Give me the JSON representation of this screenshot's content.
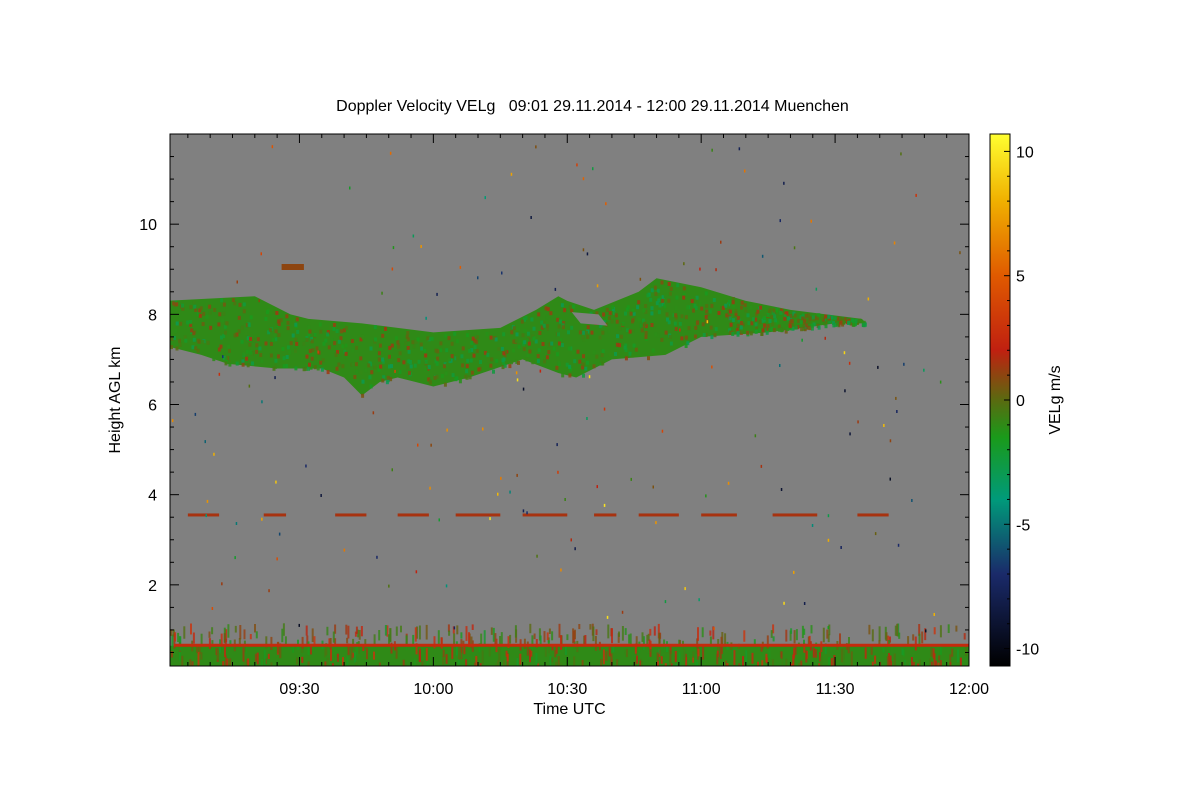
{
  "chart_data": {
    "type": "heatmap",
    "title": "Doppler Velocity VELg   09:01 29.11.2014 - 12:00 29.11.2014 Muenchen",
    "xlabel": "Time UTC",
    "ylabel": "Height AGL km",
    "x_ticks": [
      "09:30",
      "10:00",
      "10:30",
      "11:00",
      "11:30",
      "12:00"
    ],
    "x_tick_minutes": [
      30,
      60,
      90,
      120,
      150,
      180
    ],
    "xlim_minutes_after_0900": [
      1,
      180
    ],
    "y_ticks": [
      2,
      4,
      6,
      8,
      10
    ],
    "ylim": [
      0.2,
      12.0
    ],
    "colorbar": {
      "label": "VELg m/s",
      "ticks": [
        10,
        5,
        0,
        -5,
        -10
      ],
      "range": [
        -10.7,
        10.7
      ],
      "stops": [
        {
          "v": -10.7,
          "color": "#000000"
        },
        {
          "v": -7.0,
          "color": "#1a2a6a"
        },
        {
          "v": -4.0,
          "color": "#009a7a"
        },
        {
          "v": -1.5,
          "color": "#1a9a1a"
        },
        {
          "v": 0.0,
          "color": "#5a6a10"
        },
        {
          "v": 2.0,
          "color": "#c02010"
        },
        {
          "v": 5.0,
          "color": "#e05a00"
        },
        {
          "v": 8.0,
          "color": "#f0b000"
        },
        {
          "v": 10.7,
          "color": "#ffff30"
        }
      ]
    },
    "background_color": "#808080",
    "features": [
      {
        "name": "cloud layer",
        "velocity": -1,
        "top_km": [
          [
            0,
            8.3
          ],
          [
            20,
            8.4
          ],
          [
            28,
            8.0
          ],
          [
            32,
            7.9
          ],
          [
            44,
            7.8
          ],
          [
            52,
            7.7
          ],
          [
            60,
            7.6
          ],
          [
            75,
            7.7
          ],
          [
            83,
            8.1
          ],
          [
            88,
            8.4
          ],
          [
            90,
            8.3
          ],
          [
            96,
            8.1
          ],
          [
            106,
            8.5
          ],
          [
            110,
            8.8
          ],
          [
            120,
            8.6
          ],
          [
            130,
            8.3
          ],
          [
            140,
            8.1
          ],
          [
            148,
            8.0
          ],
          [
            156,
            7.9
          ],
          [
            157,
            7.8
          ]
        ],
        "bottom_km": [
          [
            0,
            7.3
          ],
          [
            8,
            7.1
          ],
          [
            14,
            6.9
          ],
          [
            25,
            6.8
          ],
          [
            28,
            6.8
          ],
          [
            35,
            6.8
          ],
          [
            40,
            6.6
          ],
          [
            44,
            6.2
          ],
          [
            48,
            6.5
          ],
          [
            52,
            6.6
          ],
          [
            60,
            6.4
          ],
          [
            68,
            6.6
          ],
          [
            80,
            7.0
          ],
          [
            88,
            6.7
          ],
          [
            92,
            6.6
          ],
          [
            100,
            7.0
          ],
          [
            112,
            7.1
          ],
          [
            120,
            7.5
          ],
          [
            135,
            7.6
          ],
          [
            150,
            7.8
          ],
          [
            157,
            7.8
          ]
        ]
      },
      {
        "name": "isolated patch",
        "velocity": 1,
        "segments": [
          [
            26,
            31,
            9.05
          ]
        ]
      },
      {
        "name": "near-ground layer",
        "velocity": -1,
        "bottom_km": 0.25,
        "top_km": 0.65
      },
      {
        "name": "red line",
        "velocity": 2.5,
        "height_km": 0.66
      },
      {
        "name": "dashed band",
        "velocity": 1.5,
        "height_km": 3.55,
        "segments": [
          [
            5,
            12
          ],
          [
            22,
            27
          ],
          [
            38,
            45
          ],
          [
            52,
            59
          ],
          [
            65,
            75
          ],
          [
            80,
            90
          ],
          [
            96,
            101
          ],
          [
            106,
            115
          ],
          [
            120,
            128
          ],
          [
            136,
            146
          ],
          [
            155,
            162
          ]
        ]
      }
    ]
  }
}
